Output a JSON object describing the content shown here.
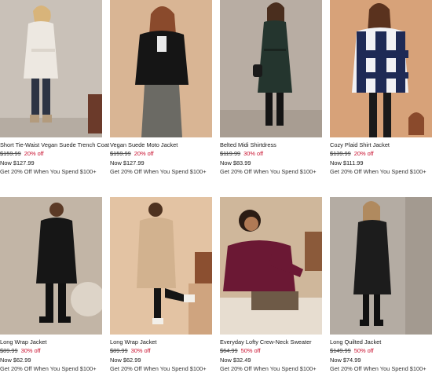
{
  "products": [
    {
      "name": "Short Tie-Waist Vegan Suede Trench Coat",
      "was": "$159.99",
      "pct": "20% off",
      "now": "Now $127.99",
      "promo": "Get 20% Off When You Spend $100+",
      "image": "woman-cream-trench-coat"
    },
    {
      "name": "Vegan Suede Moto Jacket",
      "was": "$159.99",
      "pct": "20% off",
      "now": "Now $127.99",
      "promo": "Get 20% Off When You Spend $100+",
      "image": "woman-black-moto-jacket"
    },
    {
      "name": "Belted Midi Shirtdress",
      "was": "$119.99",
      "pct": "30% off",
      "now": "Now $83.99",
      "promo": "Get 20% Off When You Spend $100+",
      "image": "woman-green-shirtdress"
    },
    {
      "name": "Cozy Plaid Shirt Jacket",
      "was": "$139.99",
      "pct": "20% off",
      "now": "Now $111.99",
      "promo": "Get 20% Off When You Spend $100+",
      "image": "woman-plaid-shirt-jacket"
    },
    {
      "name": "Long Wrap Jacket",
      "was": "$89.99",
      "pct": "30% off",
      "now": "Now $62.99",
      "promo": "Get 20% Off When You Spend $100+",
      "image": "woman-black-wrap-jacket"
    },
    {
      "name": "Long Wrap Jacket",
      "was": "$89.99",
      "pct": "30% off",
      "now": "Now $62.99",
      "promo": "Get 20% Off When You Spend $100+",
      "image": "woman-camel-wrap-jacket"
    },
    {
      "name": "Everyday Lofty Crew-Neck Sweater",
      "was": "$64.99",
      "pct": "50% off",
      "now": "Now $32.49",
      "promo": "Get 20% Off When You Spend $100+",
      "image": "woman-burgundy-sweater"
    },
    {
      "name": "Long Quilted Jacket",
      "was": "$149.99",
      "pct": "50% off",
      "now": "Now $74.99",
      "promo": "Get 20% Off When You Spend $100+",
      "image": "woman-black-quilted-jacket"
    }
  ],
  "colors": {
    "sale": "#c8102e",
    "text": "#1a1a1a"
  }
}
